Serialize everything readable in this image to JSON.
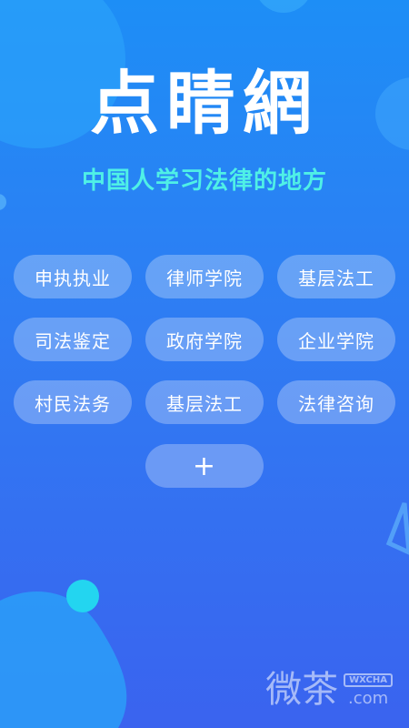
{
  "header": {
    "title": "点睛網",
    "slogan": "中国人学习法律的地方"
  },
  "categories": [
    "申执执业",
    "律师学院",
    "基层法工",
    "司法鉴定",
    "政府学院",
    "企业学院",
    "村民法务",
    "基层法工",
    "法律咨询"
  ],
  "more_label": "+",
  "watermark": {
    "glyphs": "微茶",
    "badge": "WXCHA",
    "domain": ".com"
  },
  "colors": {
    "bg_top": "#1d8ef6",
    "bg_bottom": "#3a63ef",
    "slogan": "#4ff0e6",
    "accent_blob": "#23d5f0"
  }
}
